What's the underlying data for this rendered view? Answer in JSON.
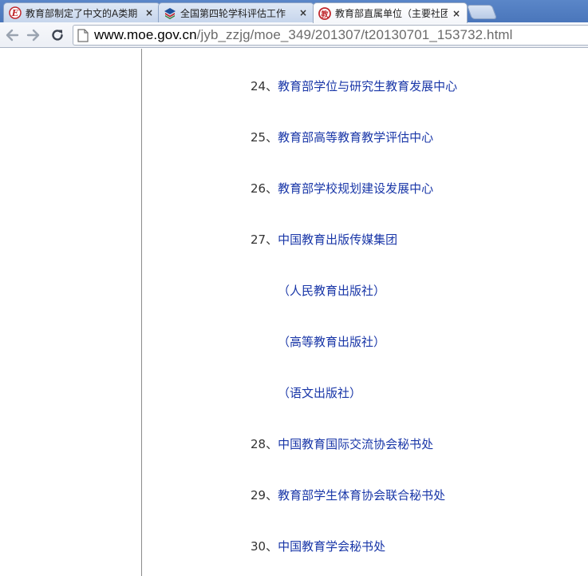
{
  "browser": {
    "tabs": [
      {
        "title": "教育部制定了中文的A类期",
        "favicon": "e-circle-icon",
        "active": false
      },
      {
        "title": "全国第四轮学科评估工作",
        "favicon": "books-icon",
        "active": false
      },
      {
        "title": "教育部直属单位（主要社团",
        "favicon": "moe-logo-icon",
        "active": true
      }
    ],
    "close_glyph": "×",
    "url_host": "www.moe.gov.cn",
    "url_path": "/jyb_zzjg/moe_349/201307/t20130701_153732.html"
  },
  "content": {
    "items": [
      {
        "num": "24、",
        "text": "教育部学位与研究生教育发展中心"
      },
      {
        "num": "25、",
        "text": "教育部高等教育教学评估中心"
      },
      {
        "num": "26、",
        "text": "教育部学校规划建设发展中心"
      },
      {
        "num": "27、",
        "text": "中国教育出版传媒集团"
      },
      {
        "num": "28、",
        "text": "中国教育国际交流协会秘书处"
      },
      {
        "num": "29、",
        "text": "教育部学生体育协会联合秘书处"
      },
      {
        "num": "30、",
        "text": "中国教育学会秘书处"
      }
    ],
    "subitems": [
      {
        "text": "（人民教育出版社）"
      },
      {
        "text": "（高等教育出版社）"
      },
      {
        "text": "（语文出版社）"
      }
    ]
  },
  "colors": {
    "link": "#1a37a8",
    "number": "#333333",
    "tabstrip": "#4a76bb",
    "url_path": "#6b6b6b"
  }
}
